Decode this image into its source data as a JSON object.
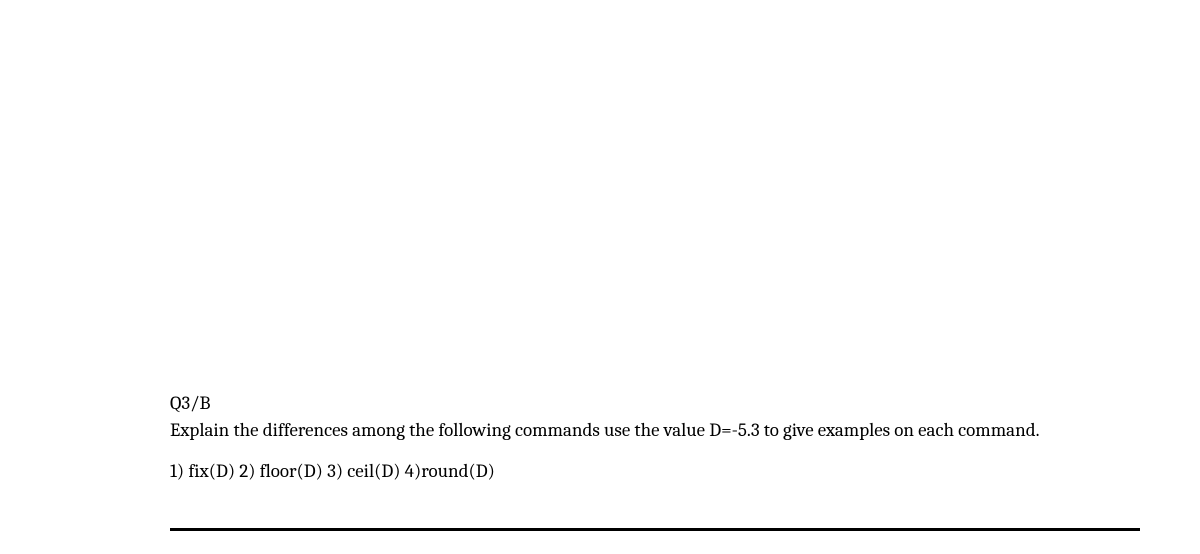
{
  "question": {
    "heading": "Q3/B",
    "prompt": "Explain the differences among the following commands use the value D=-5.3 to give examples on each command.",
    "items_line": "1) fix(D)   2) floor(D)   3) ceil(D) 4)round(D)"
  }
}
